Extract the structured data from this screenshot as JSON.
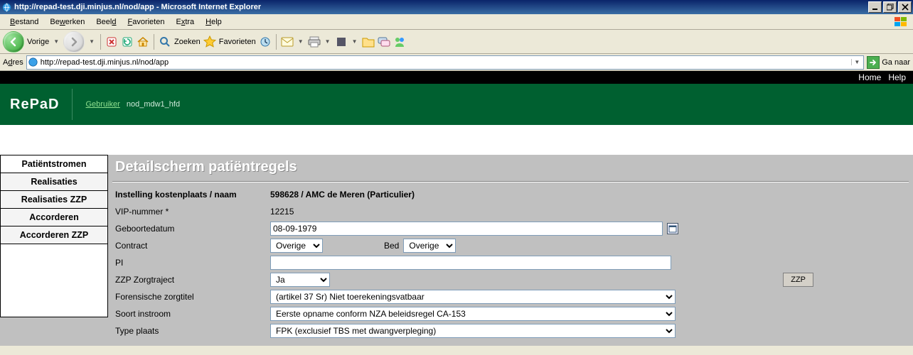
{
  "window": {
    "title": "http://repad-test.dji.minjus.nl/nod/app - Microsoft Internet Explorer"
  },
  "menu": {
    "items": [
      "Bestand",
      "Bewerken",
      "Beeld",
      "Favorieten",
      "Extra",
      "Help"
    ]
  },
  "toolbar": {
    "back": "Vorige",
    "search": "Zoeken",
    "favorites": "Favorieten"
  },
  "address": {
    "label": "Adres",
    "url": "http://repad-test.dji.minjus.nl/nod/app",
    "go": "Ga naar"
  },
  "topnav": {
    "home": "Home",
    "help": "Help"
  },
  "header": {
    "brand": "RePaD",
    "user_label": "Gebruiker",
    "user_value": "nod_mdw1_hfd"
  },
  "sidebar": {
    "tabs": [
      "Patiëntstromen",
      "Realisaties",
      "Realisaties ZZP",
      "Accorderen",
      "Accorderen ZZP"
    ]
  },
  "page": {
    "title": "Detailscherm patiëntregels"
  },
  "form": {
    "inst_label": "Instelling kostenplaats / naam",
    "inst_value": "598628 / AMC de Meren (Particulier)",
    "vip_label": "VIP-nummer *",
    "vip_value": "12215",
    "dob_label": "Geboortedatum",
    "dob_value": "08-09-1979",
    "contract_label": "Contract",
    "contract_value": "Overige",
    "bed_label": "Bed",
    "bed_value": "Overige",
    "pi_label": "PI",
    "pi_value": "",
    "zzp_label": "ZZP Zorgtraject",
    "zzp_value": "Ja",
    "zzp_button": "ZZP",
    "forens_label": "Forensische zorgtitel",
    "forens_value": "(artikel 37 Sr)  Niet toerekeningsvatbaar",
    "soort_label": "Soort instroom",
    "soort_value": "Eerste opname conform NZA beleidsregel CA-153",
    "type_label": "Type plaats",
    "type_value": "FPK (exclusief TBS met dwangverpleging)"
  }
}
